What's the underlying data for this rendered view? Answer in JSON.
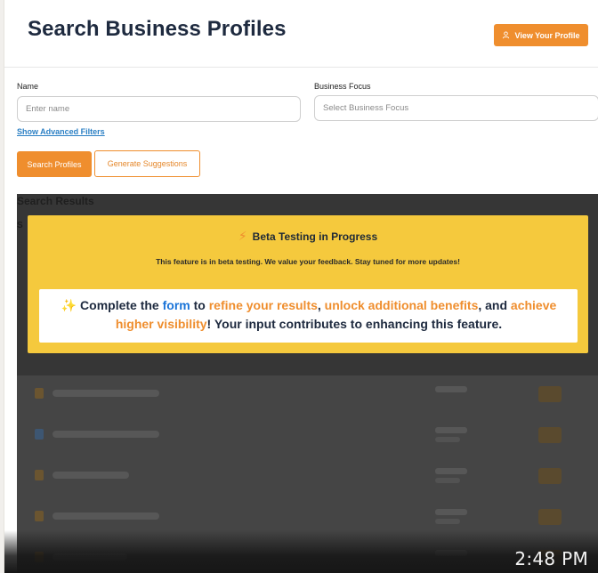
{
  "header": {
    "title": "Search Business Profiles",
    "view_profile_label": "View Your Profile"
  },
  "form": {
    "name_label": "Name",
    "name_placeholder": "Enter name",
    "focus_label": "Business Focus",
    "focus_placeholder": "Select Business Focus",
    "advanced_link": "Show Advanced Filters",
    "search_button": "Search Profiles",
    "suggest_button": "Generate Suggestions"
  },
  "results": {
    "title": "Search Results",
    "subtitle": "S"
  },
  "beta": {
    "heading": "Beta Testing in Progress",
    "subtitle": "This feature is in beta testing. We value your feedback. Stay tuned for more updates!",
    "card": {
      "intro": "Complete the",
      "link_form": "form",
      "to": "to",
      "link_refine": "refine your results",
      "comma1": ",",
      "link_unlock": "unlock additional benefits",
      "and": ", and",
      "link_visibility": "achieve higher visibility",
      "outro": "! Your input contributes to enhancing this feature."
    }
  },
  "video": {
    "timestamp": "2:48 PM"
  },
  "colors": {
    "accent": "#ef8e2e",
    "title": "#1e2a3f",
    "banner": "#f5c93d",
    "link": "#2a7fc4"
  }
}
